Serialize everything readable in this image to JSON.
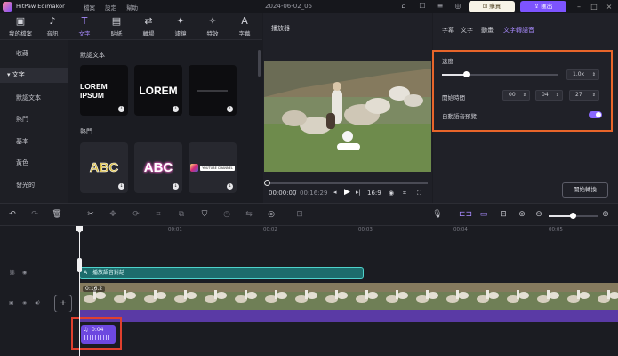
{
  "app": {
    "name": "HitPaw Edimakor",
    "menu": [
      "檔案",
      "設定",
      "幫助"
    ],
    "date": "2024-06-02_05",
    "buy_label": "購買",
    "export_label": "匯出"
  },
  "toolbar": {
    "tools": [
      {
        "label": "我的檔案",
        "icon": "folder-icon"
      },
      {
        "label": "音訊",
        "icon": "music-icon"
      },
      {
        "label": "文字",
        "icon": "text-icon"
      },
      {
        "label": "貼紙",
        "icon": "sticker-icon"
      },
      {
        "label": "轉場",
        "icon": "transition-icon"
      },
      {
        "label": "濾鏡",
        "icon": "filter-icon"
      },
      {
        "label": "特效",
        "icon": "effects-icon"
      },
      {
        "label": "字幕",
        "icon": "subtitle-icon"
      }
    ],
    "active_index": 2
  },
  "sidebar": {
    "items": [
      {
        "label": "收藏"
      },
      {
        "label": "▾ 文字"
      },
      {
        "label": "默認文本"
      },
      {
        "label": "熱門"
      },
      {
        "label": "基本"
      },
      {
        "label": "黃色"
      },
      {
        "label": "發光的"
      }
    ],
    "selected_index": 2
  },
  "library": {
    "section_default": "默認文本",
    "section_hot": "熱門",
    "default_cards": [
      "LOREM IPSUM",
      "LOREM",
      ""
    ],
    "hot_cards": [
      "ABC",
      "ABC",
      "YOUTUBE CHANNEL"
    ]
  },
  "player": {
    "title": "播放器",
    "time_current": "00:00:00",
    "time_total": "00:16:29",
    "aspect": "16:9"
  },
  "right_panel": {
    "tabs": [
      "字幕",
      "文字",
      "動畫",
      "文字轉語音"
    ],
    "active_tab": 3,
    "speed_label": "速度",
    "speed_value": "1.0x",
    "start_time_label": "開始時間",
    "start_time": [
      "00",
      "04",
      "27"
    ],
    "preview_label": "自動語音預覽",
    "convert_label": "開始轉換"
  },
  "timeline": {
    "ticks": [
      "00:01",
      "00:02",
      "00:03",
      "00:04",
      "00:05"
    ],
    "text_clip_label": "播放語音對話",
    "video_clip_time": "0:16.2",
    "small_clip_time": "0:04"
  },
  "colors": {
    "accent": "#8a68ff",
    "highlight_orange": "#e8652a",
    "highlight_red": "#e0402e",
    "text_clip": "#1d6c6c",
    "audio_track": "#5a3aa5"
  }
}
